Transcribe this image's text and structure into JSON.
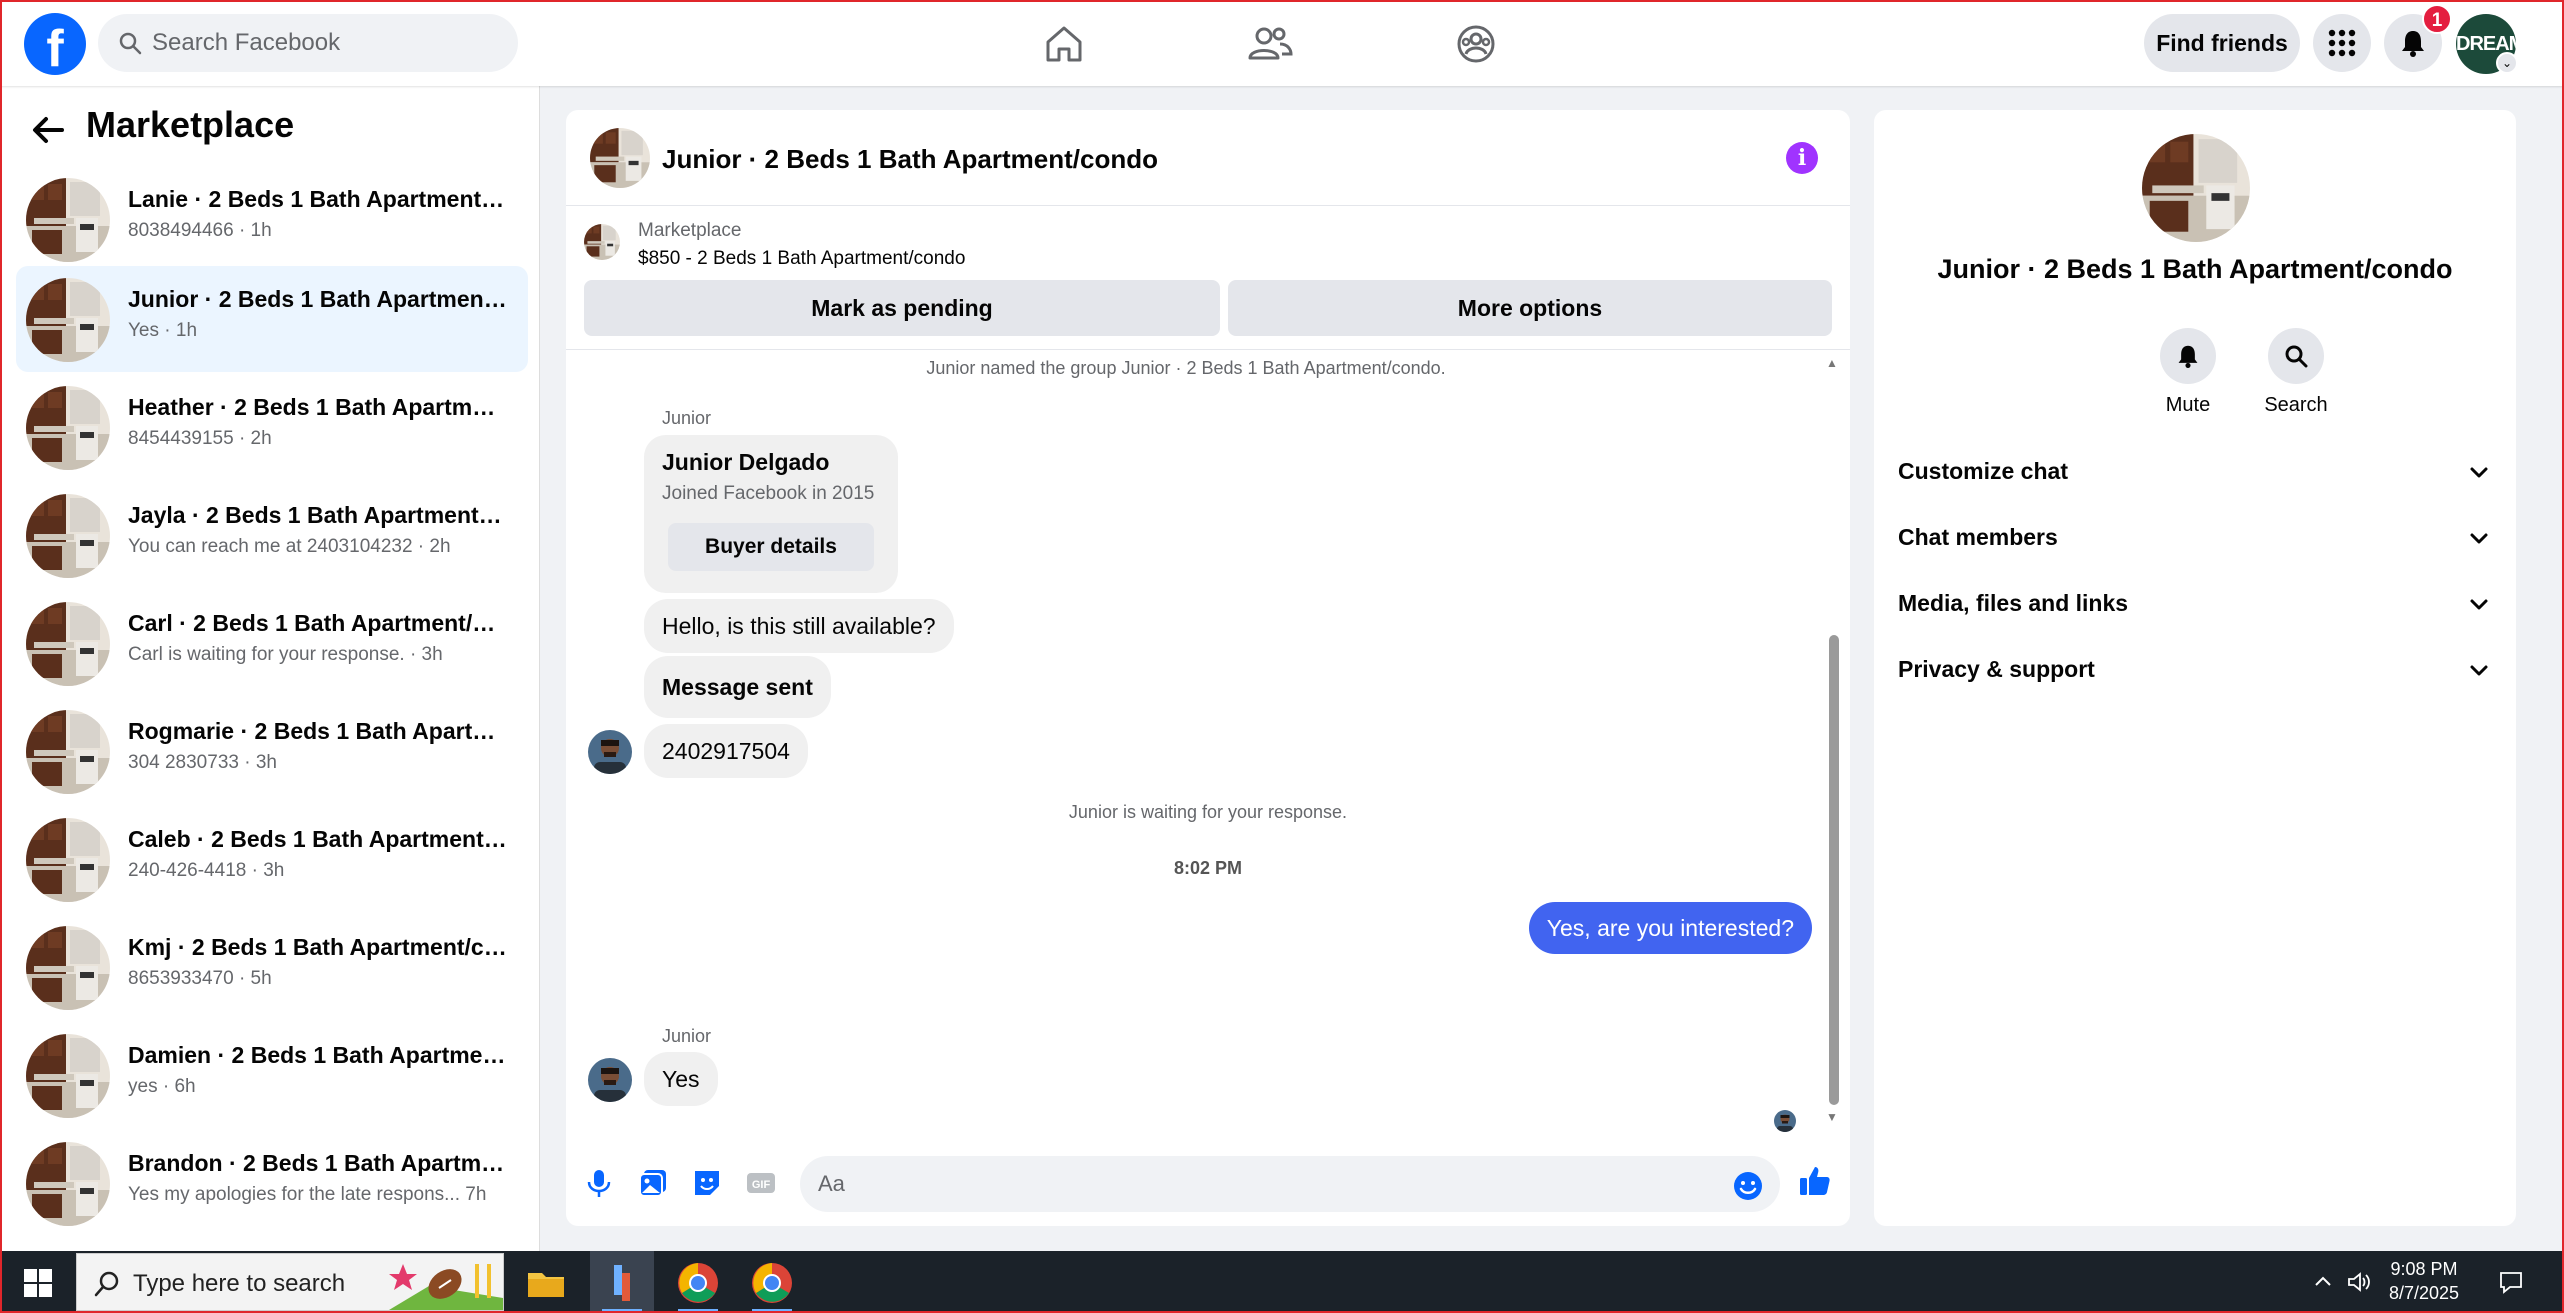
{
  "topbar": {
    "logo_letter": "f",
    "search_placeholder": "Search Facebook",
    "find_friends_label": "Find friends",
    "notification_count": "1",
    "profile_text": "DREAM"
  },
  "sidebar": {
    "title": "Marketplace",
    "conversations": [
      {
        "title": "Lanie · 2 Beds 1 Bath Apartment/c...",
        "sub": "8038494466 · 1h"
      },
      {
        "title": "Junior · 2 Beds 1 Bath Apartment/c...",
        "sub": "Yes · 1h"
      },
      {
        "title": "Heather · 2 Beds 1 Bath Apartment...",
        "sub": "8454439155 · 2h"
      },
      {
        "title": "Jayla · 2 Beds 1 Bath Apartment/co...",
        "sub": "You can reach me at 2403104232 · 2h"
      },
      {
        "title": "Carl · 2 Beds 1 Bath Apartment/co...",
        "sub": "Carl is waiting for your response. · 3h"
      },
      {
        "title": "Rogmarie · 2 Beds 1 Bath Apartme...",
        "sub": "304 2830733 · 3h"
      },
      {
        "title": "Caleb · 2 Beds 1 Bath Apartment/c...",
        "sub": "240-426-4418 · 3h"
      },
      {
        "title": "Kmj · 2 Beds 1 Bath Apartment/co...",
        "sub": "8653933470 · 5h"
      },
      {
        "title": "Damien · 2 Beds 1 Bath Apartment...",
        "sub": "yes · 6h"
      },
      {
        "title": "Brandon · 2 Beds 1 Bath Apartmen...",
        "sub": "Yes my apologies for the late respons...  7h"
      }
    ]
  },
  "chat": {
    "title": "Junior · 2 Beds 1 Bath Apartment/condo",
    "info_glyph": "i",
    "listing_source": "Marketplace",
    "listing_price": "$850 - 2 Beds 1 Bath Apartment/condo",
    "mark_pending_label": "Mark as pending",
    "more_options_label": "More options",
    "system_named": "Junior named the group Junior · 2 Beds 1 Bath Apartment/condo.",
    "sender_name": "Junior",
    "card_name": "Junior Delgado",
    "card_joined": "Joined Facebook in 2015",
    "card_button": "Buyer details",
    "msg1": "Hello, is this still available?",
    "msg2": "Message sent",
    "msg3": "2402917504",
    "system_waiting": "Junior is waiting for your response.",
    "timestamp": "8:02 PM",
    "outgoing": "Yes, are you interested?",
    "sender_name2": "Junior",
    "msg4": "Yes",
    "composer_placeholder": "Aa"
  },
  "rpanel": {
    "title": "Junior · 2 Beds 1 Bath Apartment/condo",
    "mute_label": "Mute",
    "search_label": "Search",
    "rows": [
      "Customize chat",
      "Chat members",
      "Media, files and links",
      "Privacy & support"
    ]
  },
  "taskbar": {
    "search_text": "Type here to search",
    "time": "9:08 PM",
    "date": "8/7/2025"
  },
  "colors": {
    "brand": "#0866ff",
    "outgoing_bubble": "#4164f0",
    "info_purple": "#a033ff",
    "badge_red": "#e41e3f",
    "active_row": "#ebf5ff"
  }
}
